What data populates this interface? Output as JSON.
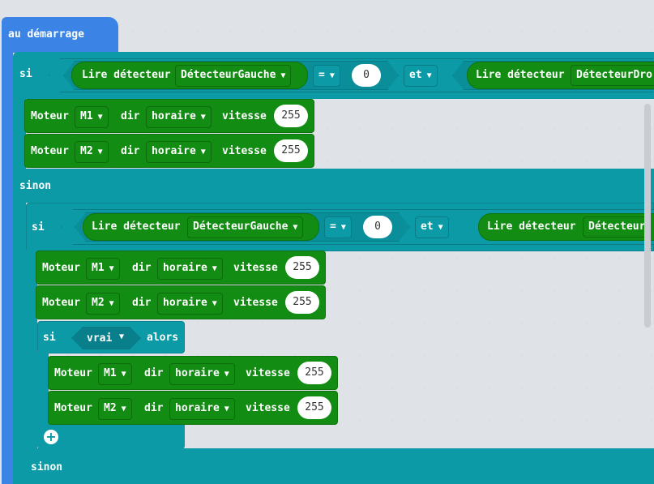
{
  "event": {
    "label": "au démarrage"
  },
  "kw": {
    "si": "si",
    "et": "et",
    "sinon": "sinon",
    "alors": "alors",
    "eq": "="
  },
  "outer_if": {
    "left": {
      "label": "Lire détecteur",
      "sensor": "DétecteurGauche",
      "value": "0"
    },
    "right": {
      "label": "Lire détecteur",
      "sensor": "DétecteurDro"
    }
  },
  "inner_if": {
    "left": {
      "label": "Lire détecteur",
      "sensor": "DétecteurGauche",
      "value": "0"
    },
    "right": {
      "label": "Lire détecteur",
      "sensor": "Détecteur"
    }
  },
  "motor": {
    "label": "Moteur",
    "dir_label": "dir",
    "direction": "horaire",
    "speed_label": "vitesse",
    "speed": "255"
  },
  "motors": [
    "M1",
    "M2"
  ],
  "cond_true": "vrai"
}
